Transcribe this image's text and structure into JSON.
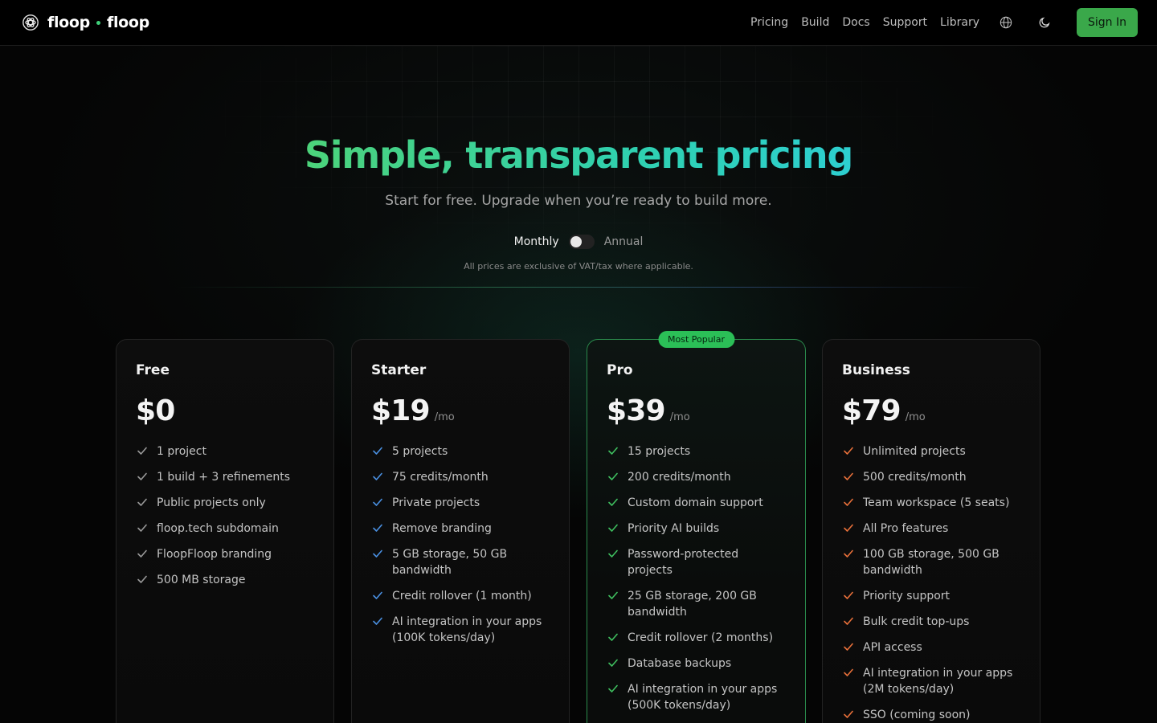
{
  "header": {
    "brand_a": "floop",
    "brand_b": "floop",
    "nav": [
      "Pricing",
      "Build",
      "Docs",
      "Support",
      "Library"
    ],
    "icons": [
      "globe-icon",
      "moon-icon"
    ],
    "signin_label": "Sign In",
    "accent_color": "#3aa84a"
  },
  "hero": {
    "title": "Simple, transparent pricing",
    "subtitle": "Start for free. Upgrade when you’re ready to build more."
  },
  "billing": {
    "monthly_label": "Monthly",
    "annual_label": "Annual",
    "annual_enabled": false,
    "tax_note": "All prices are exclusive of VAT/tax where applicable."
  },
  "plans": [
    {
      "name": "Free",
      "price": "$0",
      "period": "",
      "check_color": "#9a9a9a",
      "features": [
        "1 project",
        "1 build + 3 refinements",
        "Public projects only",
        "floop.tech subdomain",
        "FloopFloop branding",
        "500 MB storage"
      ]
    },
    {
      "name": "Starter",
      "price": "$19",
      "period": "/mo",
      "check_color": "#4a90e2",
      "features": [
        "5 projects",
        "75 credits/month",
        "Private projects",
        "Remove branding",
        "5 GB storage, 50 GB bandwidth",
        "Credit rollover (1 month)",
        "AI integration in your apps (100K tokens/day)"
      ]
    },
    {
      "name": "Pro",
      "price": "$39",
      "period": "/mo",
      "badge": "Most Popular",
      "check_color": "#3fbf5f",
      "features": [
        "15 projects",
        "200 credits/month",
        "Custom domain support",
        "Priority AI builds",
        "Password-protected projects",
        "25 GB storage, 200 GB bandwidth",
        "Credit rollover (2 months)",
        "Database backups",
        "AI integration in your apps (500K tokens/day)"
      ]
    },
    {
      "name": "Business",
      "price": "$79",
      "period": "/mo",
      "check_color": "#e8703a",
      "features": [
        "Unlimited projects",
        "500 credits/month",
        "Team workspace (5 seats)",
        "All Pro features",
        "100 GB storage, 500 GB bandwidth",
        "Priority support",
        "Bulk credit top-ups",
        "API access",
        "AI integration in your apps (2M tokens/day)",
        "SSO (coming soon)"
      ]
    }
  ]
}
